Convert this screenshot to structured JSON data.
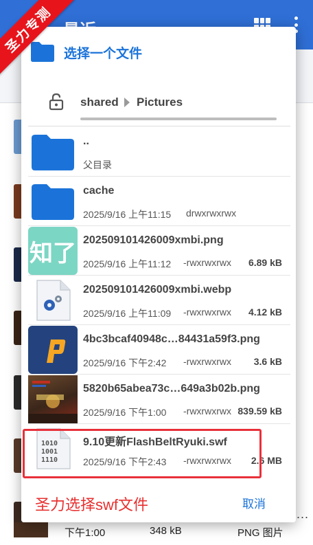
{
  "background": {
    "title": "最近",
    "bottom_row": {
      "time": "下午1:00",
      "size": "348 kB",
      "type": "PNG 图片",
      "more": "..."
    }
  },
  "watermark": "圣力专测",
  "dialog": {
    "title": "选择一个文件",
    "breadcrumb": [
      "shared",
      "Pictures"
    ],
    "rows": [
      {
        "name": "..",
        "date": "父目录",
        "perm": "",
        "size": "",
        "thumb": "folder"
      },
      {
        "name": "cache",
        "date": "2025/9/16 上午11:15",
        "perm": "drwxrwxrwx",
        "size": "",
        "thumb": "folder"
      },
      {
        "name": "202509101426009xmbi.png",
        "date": "2025/9/16 上午11:12",
        "perm": "-rwxrwxrwx",
        "size": "6.89 kB",
        "thumb": "zhiliao",
        "thumb_text": "知了"
      },
      {
        "name": "202509101426009xmbi.webp",
        "date": "2025/9/16 上午11:09",
        "perm": "-rwxrwxrwx",
        "size": "4.12 kB",
        "thumb": "settings"
      },
      {
        "name": "4bc3bcaf40948c…84431a59f3.png",
        "date": "2025/9/16 下午2:42",
        "perm": "-rwxrwxrwx",
        "size": "3.6 kB",
        "thumb": "orange-p"
      },
      {
        "name": "5820b65abea73c…649a3b02b.png",
        "date": "2025/9/16 下午1:00",
        "perm": "-rwxrwxrwx",
        "size": "839.59 kB",
        "thumb": "game"
      },
      {
        "name": "9.10更新FlashBeltRyuki.swf",
        "date": "2025/9/16 下午2:43",
        "perm": "-rwxrwxrwx",
        "size": "2.6 MB",
        "thumb": "binary",
        "thumb_text": [
          "1010",
          "1001",
          "1110"
        ]
      }
    ],
    "footer_note": "圣力选择swf文件",
    "cancel_label": "取消"
  },
  "colors": {
    "accent": "#1b73d9",
    "highlight": "#e8303a",
    "appbar": "#2f6fd6"
  }
}
